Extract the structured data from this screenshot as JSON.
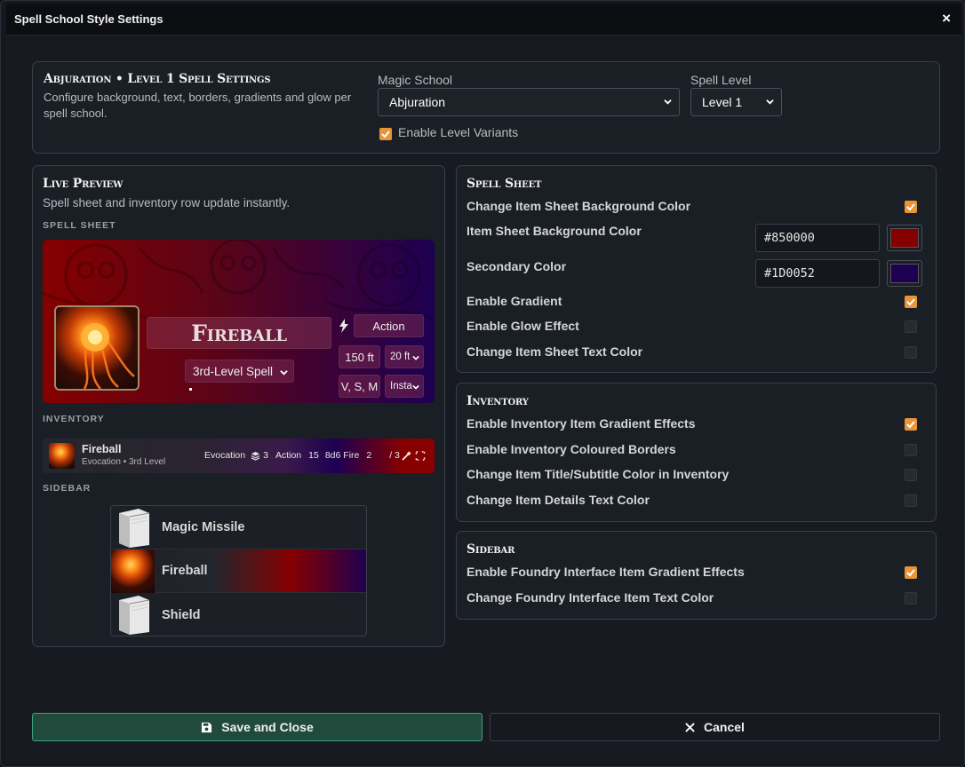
{
  "window": {
    "title": "Spell School Style Settings",
    "close_icon": "×"
  },
  "header": {
    "title": "Abjuration • Level 1 Spell Settings",
    "subtitle": "Configure background, text, borders, gradients and glow per spell school.",
    "magic_school_label": "Magic School",
    "magic_school_value": "Abjuration",
    "spell_level_label": "Spell Level",
    "spell_level_value": "Level 1",
    "level_variants_label": "Enable Level Variants",
    "level_variants_checked": true
  },
  "preview": {
    "title": "Live Preview",
    "subtitle": "Spell sheet and inventory row update instantly.",
    "spell_sheet_heading": "SPELL SHEET",
    "spell_name": "Fireball",
    "spell_level_select": "3rd-Level Spell",
    "activation": "Action",
    "range": "150 ft",
    "area": "20 ft",
    "components": "V, S, M",
    "duration": "Insta",
    "inventory_heading": "INVENTORY",
    "inventory_item": {
      "name": "Fireball",
      "meta": "Evocation • 3rd Level",
      "school": "Evocation",
      "level": "3",
      "activation": "Action",
      "range": "15",
      "damage": "8d6 Fire",
      "uses": "2",
      "max_uses": "/ 3"
    },
    "sidebar_heading": "SIDEBAR",
    "sidebar_items": [
      {
        "label": "Magic Missile"
      },
      {
        "label": "Fireball"
      },
      {
        "label": "Shield"
      }
    ]
  },
  "spell_sheet_settings": {
    "title": "Spell Sheet",
    "rows": [
      {
        "label": "Change Item Sheet Background Color",
        "checked": true
      },
      {
        "label": "Enable Gradient",
        "checked": true
      },
      {
        "label": "Enable Glow Effect",
        "checked": false
      },
      {
        "label": "Change Item Sheet Text Color",
        "checked": false
      }
    ],
    "bg_color_label": "Item Sheet Background Color",
    "bg_color_value": "#850000",
    "secondary_color_label": "Secondary Color",
    "secondary_color_value": "#1D0052"
  },
  "inventory_settings": {
    "title": "Inventory",
    "rows": [
      {
        "label": "Enable Inventory Item Gradient Effects",
        "checked": true
      },
      {
        "label": "Enable Inventory Coloured Borders",
        "checked": false
      },
      {
        "label": "Change Item Title/Subtitle Color in Inventory",
        "checked": false
      },
      {
        "label": "Change Item Details Text Color",
        "checked": false
      }
    ]
  },
  "sidebar_settings": {
    "title": "Sidebar",
    "rows": [
      {
        "label": "Enable Foundry Interface Item Gradient Effects",
        "checked": true
      },
      {
        "label": "Change Foundry Interface Item Text Color",
        "checked": false
      }
    ]
  },
  "footer": {
    "save_label": "Save and Close",
    "cancel_label": "Cancel"
  },
  "colors": {
    "accent": "#e8953a",
    "primary": "#850000",
    "secondary": "#1D0052",
    "save_bg": "#1f4a3c"
  }
}
